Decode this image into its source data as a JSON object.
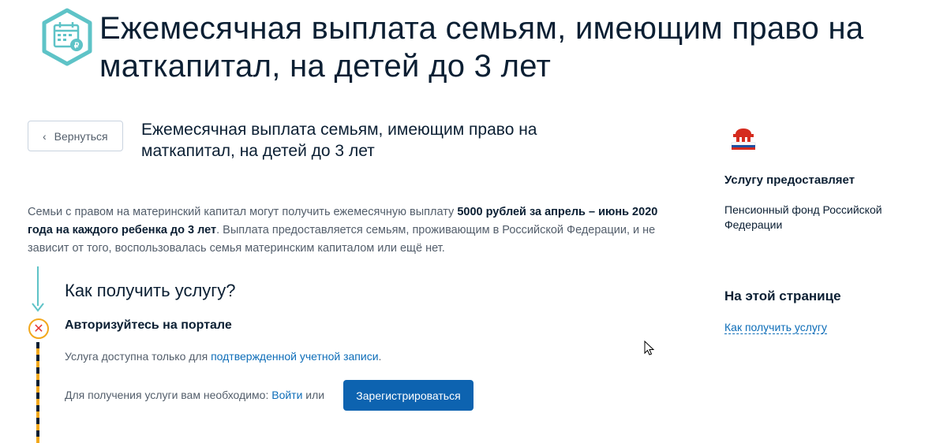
{
  "header": {
    "icon": "calendar-ruble-icon",
    "title": "Ежемесячная выплата семьям, имеющим право на маткапитал, на детей до 3 лет"
  },
  "back_button": {
    "label": "Вернуться",
    "icon": "chevron-left-icon"
  },
  "service": {
    "title": "Ежемесячная выплата семьям, имеющим право на маткапитал, на детей до 3 лет",
    "intro": {
      "part1": "Семьи с правом на материнский капитал могут получить ежемесячную выплату ",
      "bold": "5000 рублей за апрель – июнь 2020 года на каждого ребенка до 3 лет",
      "part2": ". Выплата предоставляется семьям, проживающим в Российской Федерации, и не зависит от того, воспользовалась семья материнским капиталом или ещё нет."
    }
  },
  "how_to": {
    "heading": "Как получить услугу?",
    "step1": {
      "title": "Авторизуйтесь на портале",
      "status_icon": "x-circle-icon",
      "access_prefix": "Услуга доступна только для ",
      "access_link": "подтвержденной учетной записи",
      "access_suffix": ".",
      "need_prefix": "Для получения услуги вам необходимо: ",
      "login_link": "Войти",
      "need_or": " или",
      "register_label": "Зарегистрироваться"
    }
  },
  "sidebar": {
    "logo": "pfr-logo",
    "provider_label": "Услугу предоставляет",
    "provider_name": "Пенсионный фонд Российской Федерации",
    "onpage_heading": "На этой странице",
    "onpage_link": "Как получить услугу"
  },
  "colors": {
    "accent_teal": "#5ec3c7",
    "primary_button": "#0d63b0",
    "link": "#0d6db8",
    "warning": "#f2a81d",
    "error": "#e53935"
  }
}
